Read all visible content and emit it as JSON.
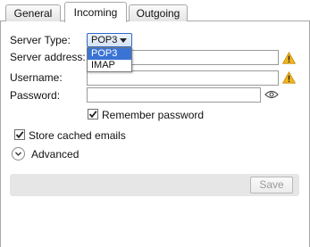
{
  "tabs": [
    {
      "label": "General",
      "active": false
    },
    {
      "label": "Incoming",
      "active": true
    },
    {
      "label": "Outgoing",
      "active": false
    }
  ],
  "form": {
    "server_type": {
      "label": "Server Type:",
      "selected": "POP3",
      "options": [
        "POP3",
        "IMAP"
      ],
      "highlighted_option": "POP3"
    },
    "server_address": {
      "label": "Server address:",
      "value": ""
    },
    "username": {
      "label": "Username:",
      "value": ""
    },
    "password": {
      "label": "Password:",
      "value": ""
    },
    "remember_password": {
      "label": "Remember password",
      "checked": true
    },
    "store_cached_emails": {
      "label": "Store cached emails",
      "checked": true
    },
    "advanced": {
      "label": "Advanced",
      "expanded": false
    }
  },
  "actions": {
    "save_label": "Save",
    "save_enabled": false
  },
  "icons": {
    "server_address_status": "warning-icon",
    "username_status": "warning-icon",
    "password_toggle": "eye-icon",
    "advanced_toggle": "chevron-down-icon"
  },
  "colors": {
    "warning": "#f2b51e",
    "selection": "#3a73d4",
    "tab_border": "#a8a8a8",
    "button_bar": "#e6e6e6"
  }
}
